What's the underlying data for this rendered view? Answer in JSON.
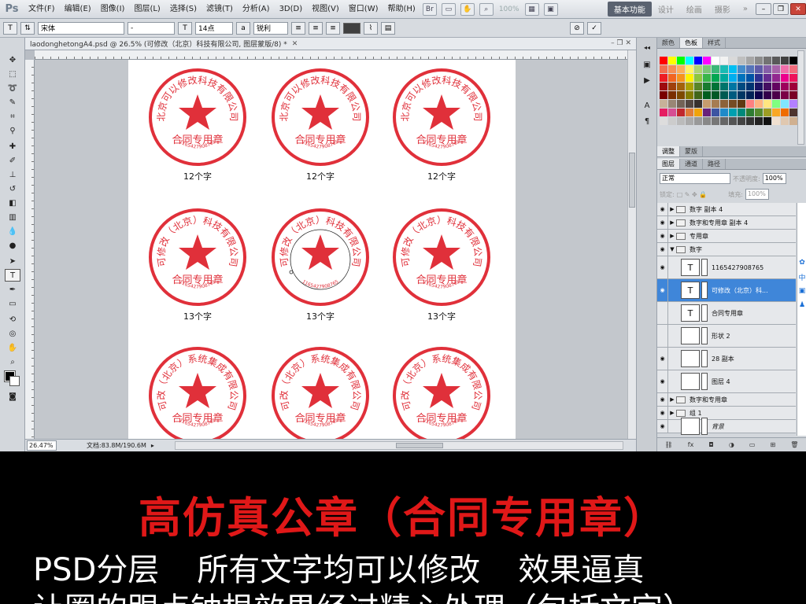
{
  "app": {
    "logo": "Ps",
    "menu": [
      "文件(F)",
      "编辑(E)",
      "图像(I)",
      "图层(L)",
      "选择(S)",
      "滤镜(T)",
      "分析(A)",
      "3D(D)",
      "视图(V)",
      "窗口(W)",
      "帮助(H)"
    ],
    "zoom_level": "100%",
    "workspace_active": "基本功能",
    "workspaces": [
      "设计",
      "绘画",
      "摄影"
    ]
  },
  "options_bar": {
    "tool_icon": "T",
    "font_family": "宋体",
    "font_style": "-",
    "font_size": "14点",
    "aa_label": "a",
    "aa_mode": "锐利"
  },
  "document": {
    "tab_title": "laodonghetongA4.psd @ 26.5% (可修改（北京）科技有限公司, 图层蒙版/8) *",
    "zoom": "26.47%",
    "doc_info": "文档:83.8M/190.6M"
  },
  "stamps": [
    {
      "company": "北京可以修改科技有限公司",
      "center": "合同专用章",
      "serial": "1165427908765",
      "caption": "12个字"
    },
    {
      "company": "北京可以修改科技有限公司",
      "center": "合同专用章",
      "serial": "1165427908765",
      "caption": "12个字"
    },
    {
      "company": "北京可以修改科技有限公司",
      "center": "合同专用章",
      "serial": "1165427908765",
      "caption": "12个字"
    },
    {
      "company": "可修改（北京）科技有限公司",
      "center": "合同专用章",
      "serial": "1165427908765",
      "caption": "13个字"
    },
    {
      "company": "可修改（北京）科技有限公司",
      "center": "",
      "serial": "1165427908765",
      "caption": "13个字"
    },
    {
      "company": "可修改（北京）科技有限公司",
      "center": "合同专用章",
      "serial": "1165427908765",
      "caption": "13个字"
    },
    {
      "company": "可改（北京）系统集成有限公司",
      "center": "合同专用章",
      "serial": "1165427908765",
      "caption": ""
    },
    {
      "company": "可改（北京）系统集成有限公司",
      "center": "合同专用章",
      "serial": "1165427908765",
      "caption": ""
    },
    {
      "company": "可改（北京）系统集成有限公司",
      "center": "合同专用章",
      "serial": "1165427908765",
      "caption": ""
    }
  ],
  "stamp_color": "#e0303a",
  "panels": {
    "swatches_tabs": [
      "颜色",
      "色板",
      "样式"
    ],
    "adjust_tabs": [
      "调整",
      "蒙版"
    ],
    "layers_tabs": [
      "图层",
      "通道",
      "路径"
    ],
    "blend_mode": "正常",
    "opacity_label": "不透明度:",
    "opacity": "100%",
    "lock_label": "锁定:",
    "fill_label": "填充:",
    "fill": "100%"
  },
  "layers": [
    {
      "name": "数字 副本 4",
      "kind": "group",
      "visible": true
    },
    {
      "name": "数字和专用章 副本 4",
      "kind": "group",
      "visible": true
    },
    {
      "name": "专用章",
      "kind": "group",
      "visible": true
    },
    {
      "name": "数字",
      "kind": "group-open",
      "visible": true
    },
    {
      "name": "1165427908765",
      "kind": "text",
      "visible": true
    },
    {
      "name": "可修改（北京）科...",
      "kind": "text",
      "visible": true,
      "selected": true
    },
    {
      "name": "合同专用章",
      "kind": "text",
      "visible": false
    },
    {
      "name": "形状 2",
      "kind": "shape",
      "visible": false
    },
    {
      "name": "28 副本",
      "kind": "pixel",
      "visible": true
    },
    {
      "name": "图层 4",
      "kind": "pixel",
      "visible": true
    },
    {
      "name": "数字和专用章",
      "kind": "group",
      "visible": true
    },
    {
      "name": "组 1",
      "kind": "group",
      "visible": true
    },
    {
      "name": "背景",
      "kind": "background",
      "visible": true
    }
  ],
  "banner": {
    "title": "高仿真公章（合同专用章）",
    "line2": [
      "PSD分层",
      "所有",
      "文字",
      "均",
      "可以修改",
      "效果",
      "逼真"
    ],
    "line3": "让圈的跟点钟根效果经过精心处理（包括文字）"
  }
}
